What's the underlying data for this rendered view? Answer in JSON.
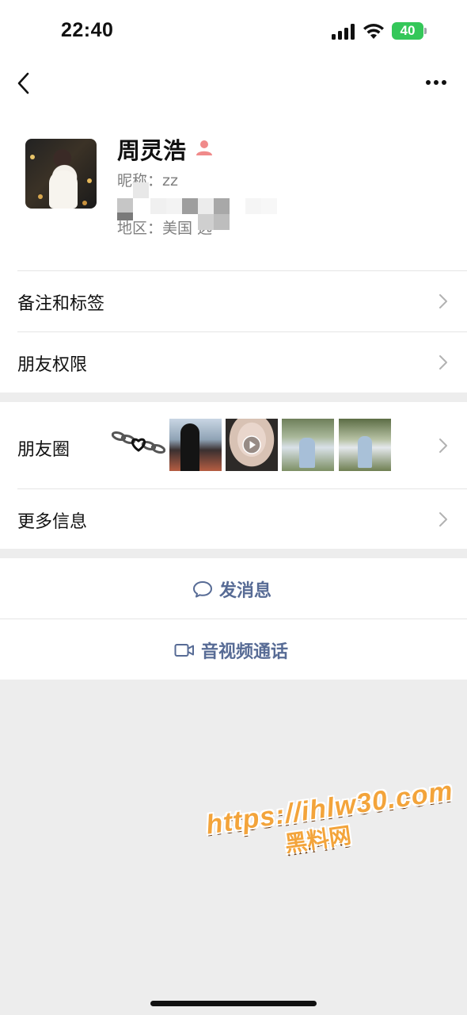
{
  "status_bar": {
    "time": "22:40",
    "battery": "40"
  },
  "profile": {
    "name": "周灵浩",
    "nickname": "昵称：zz",
    "region": "地区：美国 选"
  },
  "menu": {
    "remark_tags": "备注和标签",
    "friend_permissions": "朋友权限",
    "moments": "朋友圈",
    "more_info": "更多信息"
  },
  "actions": {
    "send_message": "发消息",
    "video_call": "音视频通话"
  },
  "watermark": {
    "line1": "https://ihlw30.com",
    "line2": "黑料网"
  },
  "colors": {
    "link_blue": "#576b95",
    "battery_green": "#34c759",
    "watermark_orange": "#f3a43b"
  }
}
